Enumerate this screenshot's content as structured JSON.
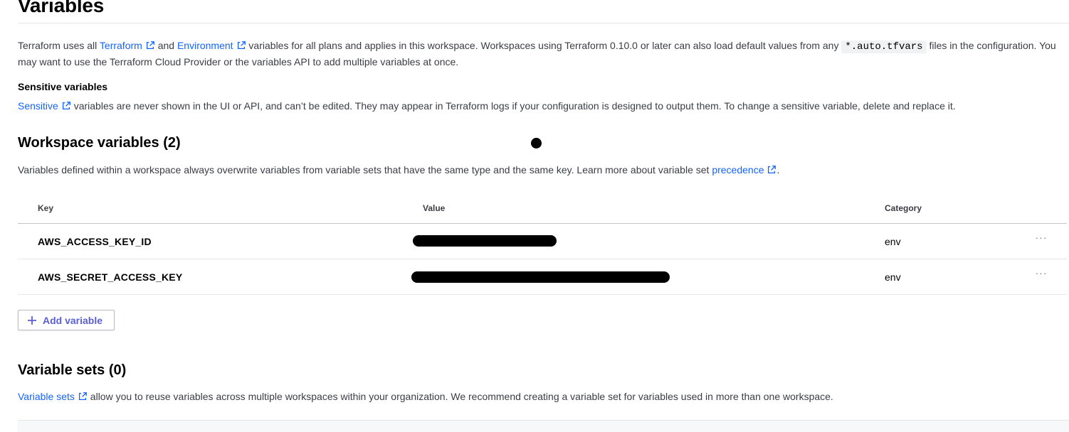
{
  "page": {
    "title": "Variables"
  },
  "intro": {
    "text1": "Terraform uses all ",
    "terraform_link": "Terraform",
    "text2": " and ",
    "environment_link": "Environment",
    "text3": " variables for all plans and applies in this workspace. Workspaces using Terraform 0.10.0 or later can also load default values from any ",
    "code": "*.auto.tfvars",
    "text4": " files in the configuration. You may want to use the Terraform Cloud Provider or the variables API to add multiple variables at once."
  },
  "sensitive": {
    "heading": "Sensitive variables",
    "link": "Sensitive",
    "text": " variables are never shown in the UI or API, and can’t be edited. They may appear in Terraform logs if your configuration is designed to output them. To change a sensitive variable, delete and replace it."
  },
  "workspace_variables": {
    "heading": "Workspace variables (2)",
    "description": "Variables defined within a workspace always overwrite variables from variable sets that have the same type and the same key. Learn more about variable set ",
    "link": "precedence",
    "trailing": ".",
    "columns": {
      "key": "Key",
      "value": "Value",
      "category": "Category"
    },
    "rows": [
      {
        "key": "AWS_ACCESS_KEY_ID",
        "value_redacted": true,
        "category": "env"
      },
      {
        "key": "AWS_SECRET_ACCESS_KEY",
        "value_redacted": true,
        "category": "env"
      }
    ],
    "row_menu_label": "···",
    "add_button": "Add variable"
  },
  "variable_sets": {
    "heading": "Variable sets (0)",
    "link": "Variable sets",
    "text": " allow you to reuse variables across multiple workspaces within your organization. We recommend creating a variable set for variables used in more than one workspace."
  },
  "colors": {
    "link": "#1563ff",
    "button_text": "#5a5fd1",
    "heading": "#000000",
    "body": "#3b3d45"
  }
}
